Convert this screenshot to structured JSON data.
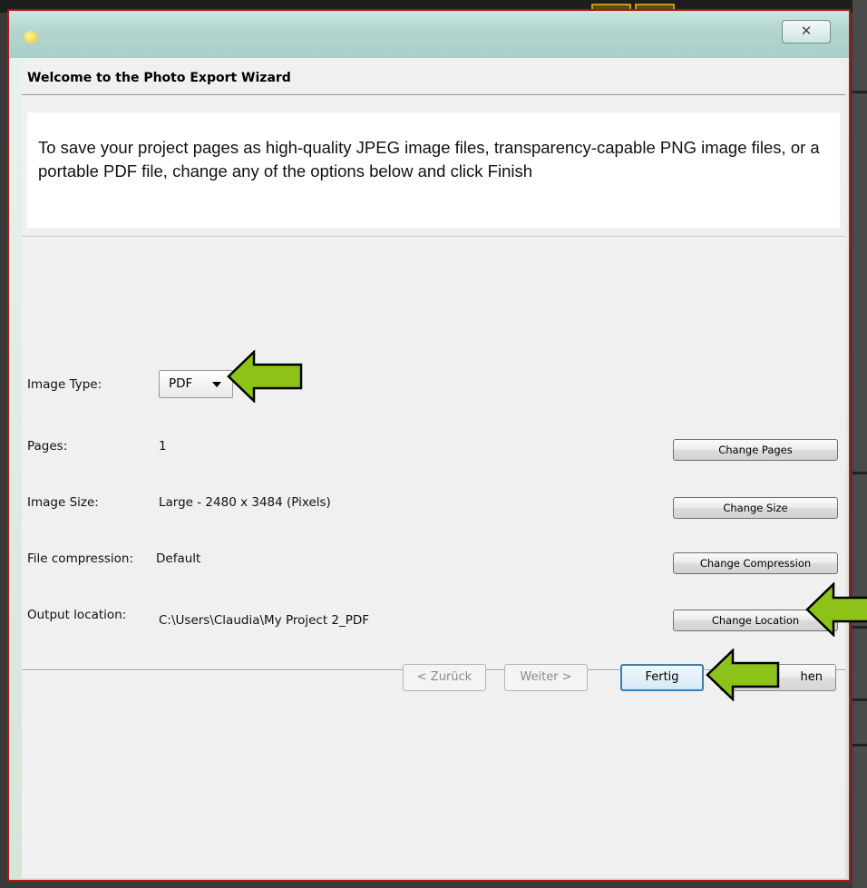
{
  "window": {
    "close_glyph": "✕"
  },
  "header": {
    "title": "Welcome to the Photo Export Wizard"
  },
  "intro": {
    "text": "To save your project pages as high-quality JPEG image files, transparency-capable PNG image files, or a portable PDF file, change any of the options below and click Finish"
  },
  "options": {
    "image_type": {
      "label": "Image Type:",
      "selected": "PDF"
    },
    "pages": {
      "label": "Pages:",
      "value": "1",
      "button": "Change Pages"
    },
    "image_size": {
      "label": "Image Size:",
      "value": "Large - 2480 x 3484 (Pixels)",
      "button": "Change Size"
    },
    "compression": {
      "label": "File compression:",
      "value": "Default",
      "button": "Change Compression"
    },
    "output": {
      "label": "Output location:",
      "value": "C:\\Users\\Claudia\\My Project 2_PDF",
      "button": "Change Location"
    }
  },
  "footer": {
    "back": "< Zurück",
    "next": "Weiter >",
    "finish": "Fertig",
    "cancel_partial": "hen"
  },
  "colors": {
    "arrow_fill": "#8cc21a",
    "arrow_stroke": "#000000",
    "window_border": "#b01818",
    "titlebar": "#b2d6cf"
  },
  "icons": [
    "app-icon",
    "close-icon",
    "dropdown-caret-icon",
    "annotation-arrow-icon"
  ]
}
